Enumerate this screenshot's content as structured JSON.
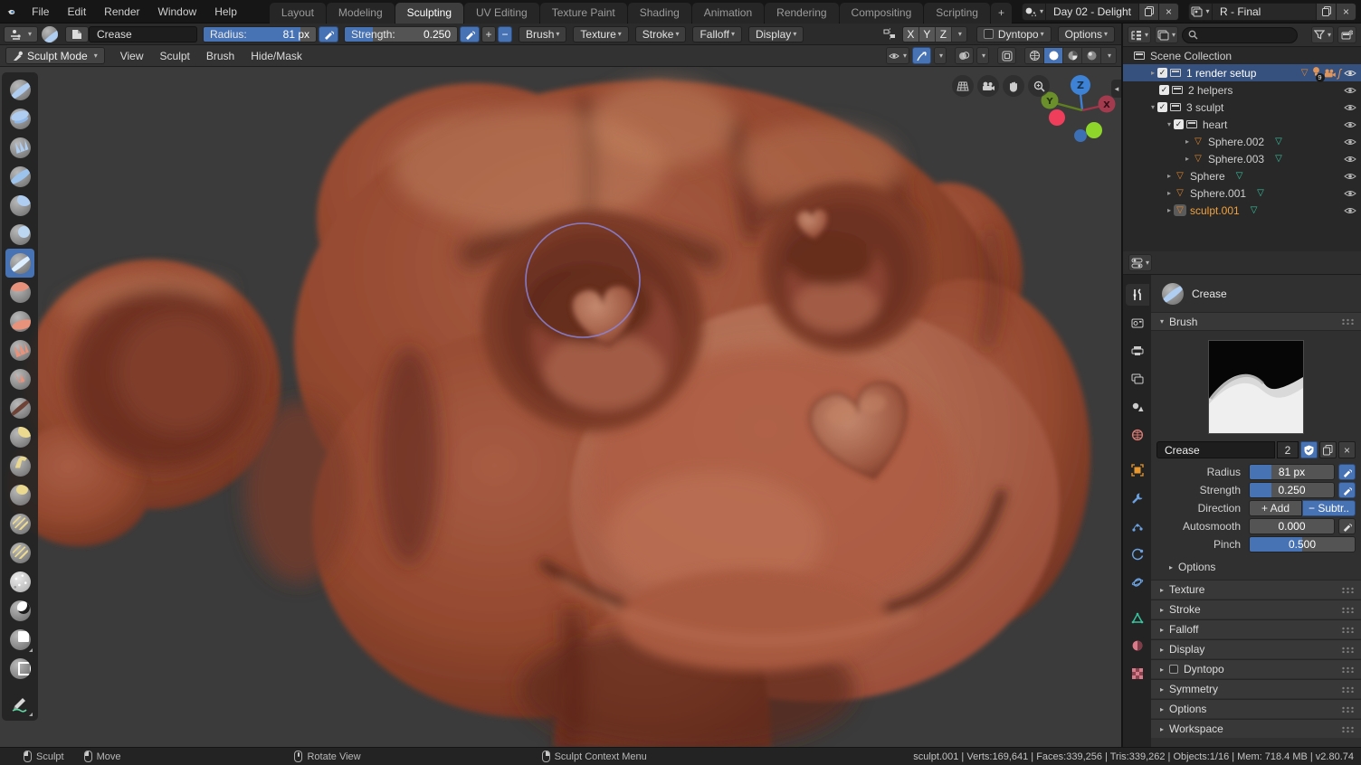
{
  "colors": {
    "accent_blue": "#4772b3",
    "object_orange": "#e0862d",
    "mesh_data_green": "#37c29d",
    "active_object_text": "#f2a23c",
    "clay_base": "#9a4c38",
    "viewport_bg": "#3b3b3b"
  },
  "topbar": {
    "app_menu": [
      "File",
      "Edit",
      "Render",
      "Window",
      "Help"
    ],
    "workspaces": [
      "Layout",
      "Modeling",
      "Sculpting",
      "UV Editing",
      "Texture Paint",
      "Shading",
      "Animation",
      "Rendering",
      "Compositing",
      "Scripting"
    ],
    "active_workspace": "Sculpting",
    "add_workspace_label": "+",
    "scene_name": "Day 02 - Delight",
    "view_layer_name": "R - Final",
    "close_label": "×"
  },
  "tool_settings": {
    "brush_name": "Crease",
    "radius_label": "Radius:",
    "radius_value": "81 px",
    "radius_fill_pct": 86,
    "strength_label": "Strength:",
    "strength_value": "0.250",
    "strength_fill_pct": 25,
    "add_label": "+",
    "subtract_label": "−",
    "popovers": [
      "Brush",
      "Texture",
      "Stroke",
      "Falloff",
      "Display"
    ],
    "mirror_axes": [
      "X",
      "Y",
      "Z"
    ],
    "dyntopo_label": "Dyntopo",
    "options_label": "Options"
  },
  "view_header": {
    "mode": "Sculpt Mode",
    "menus": [
      "View",
      "Sculpt",
      "Brush",
      "Hide/Mask"
    ]
  },
  "toolbar_tools": [
    "draw",
    "clay",
    "clay-strips",
    "layer",
    "inflate",
    "blob",
    "crease",
    "smooth",
    "flatten",
    "scrape",
    "pinch",
    "grab",
    "elastic-deform",
    "snake-hook",
    "thumb",
    "nudge",
    "rotate",
    "simplify",
    "mask",
    "box-mask",
    "box-hide",
    "annotate"
  ],
  "toolbar_active_tool": "crease",
  "viewport": {
    "gizmo_x": "X",
    "gizmo_y": "Y",
    "gizmo_z": "Z"
  },
  "outliner": {
    "root_label": "Scene Collection",
    "rows": [
      {
        "label": "1 render setup",
        "badge": "9"
      },
      {
        "label": "2 helpers"
      },
      {
        "label": "3 sculpt"
      },
      {
        "label": "heart"
      },
      {
        "label": "Sphere.002"
      },
      {
        "label": "Sphere.003"
      },
      {
        "label": "Sphere"
      },
      {
        "label": "Sphere.001"
      },
      {
        "label": "sculpt.001"
      }
    ],
    "check": "✓"
  },
  "properties": {
    "active_tool_title": "Crease",
    "brush_panel_label": "Brush",
    "name_field_value": "Crease",
    "users_count": "2",
    "radius_label": "Radius",
    "radius_value": "81 px",
    "radius_fill_pct": 26,
    "strength_label": "Strength",
    "strength_value": "0.250",
    "strength_fill_pct": 26,
    "direction_label": "Direction",
    "direction_add": "+ Add",
    "direction_subtract": "− Subtr..",
    "autosmooth_label": "Autosmooth",
    "autosmooth_value": "0.000",
    "autosmooth_fill_pct": 0,
    "pinch_label": "Pinch",
    "pinch_value": "0.500",
    "pinch_fill_pct": 50,
    "options_subpanel_label": "Options",
    "sections": [
      "Texture",
      "Stroke",
      "Falloff",
      "Display",
      "Dyntopo",
      "Symmetry",
      "Options",
      "Workspace"
    ],
    "close_label": "×"
  },
  "statusbar": {
    "hints": [
      {
        "label": "Sculpt",
        "button": "mouse-left"
      },
      {
        "label": "Move",
        "button": "mouse-left-drag"
      },
      {
        "label": "Rotate View",
        "button": "mouse-middle"
      },
      {
        "label": "Sculpt Context Menu",
        "button": "mouse-right"
      }
    ],
    "info": "sculpt.001 | Verts:169,641 | Faces:339,256 | Tris:339,262 | Objects:1/16 | Mem: 718.4 MB | v2.80.74"
  }
}
